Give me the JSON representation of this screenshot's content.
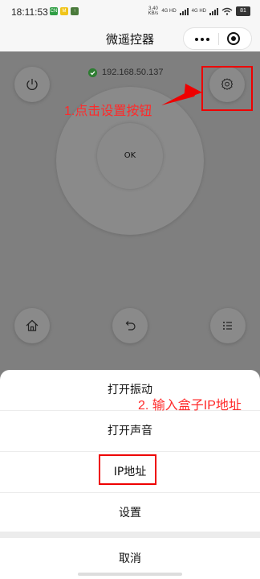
{
  "status_bar": {
    "time": "18:11:53",
    "app_icons": [
      {
        "label": "CN",
        "color": "#2f9e44"
      },
      {
        "label": "M",
        "color": "#f0c419"
      },
      {
        "label": "↑",
        "color": "#4a7a3b"
      }
    ],
    "speed": "3.40",
    "speed_unit": "KB/s",
    "network_1": "4G HD",
    "network_2": "4G HD",
    "battery": "81"
  },
  "header": {
    "title": "微遥控器"
  },
  "remote": {
    "ip_address": "192.168.50.137",
    "ok_label": "OK",
    "status_color": "#2e7d32"
  },
  "annotations": {
    "step1": "1.点击设置按钮",
    "step2": "2. 输入盒子IP地址",
    "color": "#e00000"
  },
  "action_sheet": {
    "items": [
      {
        "label": "打开振动"
      },
      {
        "label": "打开声音"
      },
      {
        "label": "IP地址"
      },
      {
        "label": "设置"
      }
    ],
    "cancel": "取消"
  }
}
